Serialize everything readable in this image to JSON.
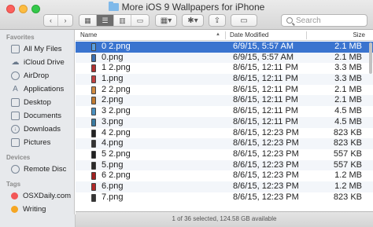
{
  "window": {
    "title": "More iOS 9 Wallpapers for iPhone"
  },
  "toolbar": {
    "back_icon": "chevron-left-icon",
    "forward_icon": "chevron-right-icon",
    "view_modes": [
      "icon-view",
      "list-view",
      "column-view",
      "cover-flow-view"
    ],
    "active_view": "list-view",
    "search_placeholder": "Search"
  },
  "sidebar": {
    "favorites_header": "Favorites",
    "favorites": [
      {
        "label": "All My Files",
        "icon": "all-files-icon"
      },
      {
        "label": "iCloud Drive",
        "icon": "cloud-icon"
      },
      {
        "label": "AirDrop",
        "icon": "airdrop-icon"
      },
      {
        "label": "Applications",
        "icon": "applications-icon"
      },
      {
        "label": "Desktop",
        "icon": "desktop-icon"
      },
      {
        "label": "Documents",
        "icon": "documents-icon"
      },
      {
        "label": "Downloads",
        "icon": "downloads-icon"
      },
      {
        "label": "Pictures",
        "icon": "pictures-icon"
      }
    ],
    "devices_header": "Devices",
    "devices": [
      {
        "label": "Remote Disc",
        "icon": "disc-icon"
      }
    ],
    "tags_header": "Tags",
    "tags": [
      {
        "label": "OSXDaily.com",
        "color": "#f25757"
      },
      {
        "label": "Writing",
        "color": "#f5a623"
      }
    ]
  },
  "columns": {
    "name": "Name",
    "date": "Date Modified",
    "size": "Size"
  },
  "files": [
    {
      "name": "0 2.png",
      "date": "6/9/15, 5:57 AM",
      "size": "2.1 MB",
      "selected": true,
      "thumb": "#5aa0e0"
    },
    {
      "name": "0.png",
      "date": "6/9/15, 5:57 AM",
      "size": "2.1 MB",
      "thumb": "#3a6fb0"
    },
    {
      "name": "1 2.png",
      "date": "8/6/15, 12:11 PM",
      "size": "3.3 MB",
      "thumb": "#b03030"
    },
    {
      "name": "1.png",
      "date": "8/6/15, 12:11 PM",
      "size": "3.3 MB",
      "thumb": "#c04040"
    },
    {
      "name": "2 2.png",
      "date": "8/6/15, 12:11 PM",
      "size": "2.1 MB",
      "thumb": "#d08a40"
    },
    {
      "name": "2.png",
      "date": "8/6/15, 12:11 PM",
      "size": "2.1 MB",
      "thumb": "#c07a30"
    },
    {
      "name": "3 2.png",
      "date": "8/6/15, 12:11 PM",
      "size": "4.5 MB",
      "thumb": "#4a90c0"
    },
    {
      "name": "3.png",
      "date": "8/6/15, 12:11 PM",
      "size": "4.5 MB",
      "thumb": "#3a7aa0"
    },
    {
      "name": "4 2.png",
      "date": "8/6/15, 12:23 PM",
      "size": "823 KB",
      "thumb": "#222222"
    },
    {
      "name": "4.png",
      "date": "8/6/15, 12:23 PM",
      "size": "823 KB",
      "thumb": "#333333"
    },
    {
      "name": "5 2.png",
      "date": "8/6/15, 12:23 PM",
      "size": "557 KB",
      "thumb": "#222222"
    },
    {
      "name": "5.png",
      "date": "8/6/15, 12:23 PM",
      "size": "557 KB",
      "thumb": "#2a2a2a"
    },
    {
      "name": "6 2.png",
      "date": "8/6/15, 12:23 PM",
      "size": "1.2 MB",
      "thumb": "#a02020"
    },
    {
      "name": "6.png",
      "date": "8/6/15, 12:23 PM",
      "size": "1.2 MB",
      "thumb": "#b02828"
    },
    {
      "name": "7.png",
      "date": "8/6/15, 12:23 PM",
      "size": "823 KB",
      "thumb": "#333333"
    }
  ],
  "status": "1 of 36 selected, 124.58 GB available"
}
